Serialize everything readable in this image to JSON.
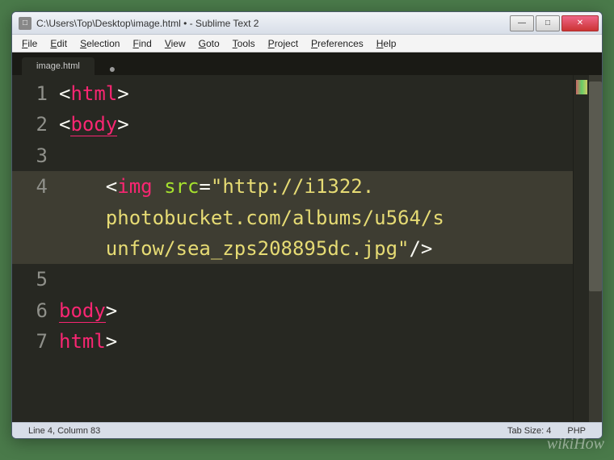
{
  "window": {
    "title": "C:\\Users\\Top\\Desktop\\image.html • - Sublime Text 2",
    "icon_char": "□"
  },
  "win_buttons": {
    "minimize": "—",
    "maximize": "□",
    "close": "✕"
  },
  "menu": [
    {
      "u": "F",
      "rest": "ile"
    },
    {
      "u": "E",
      "rest": "dit"
    },
    {
      "u": "S",
      "rest": "election"
    },
    {
      "u": "F",
      "rest": "ind"
    },
    {
      "u": "V",
      "rest": "iew"
    },
    {
      "u": "G",
      "rest": "oto"
    },
    {
      "u": "T",
      "rest": "ools"
    },
    {
      "u": "P",
      "rest": "roject"
    },
    {
      "u": "P",
      "rest": "references"
    },
    {
      "u": "H",
      "rest": "elp"
    }
  ],
  "tab": {
    "name": "image.html",
    "dirty": "●"
  },
  "line_numbers": [
    "1",
    "2",
    "3",
    "4",
    "5",
    "6",
    "7"
  ],
  "highlighted_line_index": 3,
  "code": {
    "lt": "<",
    "gt": ">",
    "slash": "/",
    "eq": "=",
    "quote": "\"",
    "tag_html": "html",
    "tag_body": "body",
    "tag_img": "img",
    "attr_src": "src",
    "str_l1": "http://i1322.",
    "str_l2": "photobucket.com/albums/u564/s",
    "str_l3": "unfow/sea_zps208895dc.jpg",
    "indent1": "  ",
    "indent2": "    "
  },
  "status": {
    "left": "Line 4, Column 83",
    "tabsize": "Tab Size: 4",
    "lang": "PHP"
  },
  "watermark": "wikiHow"
}
